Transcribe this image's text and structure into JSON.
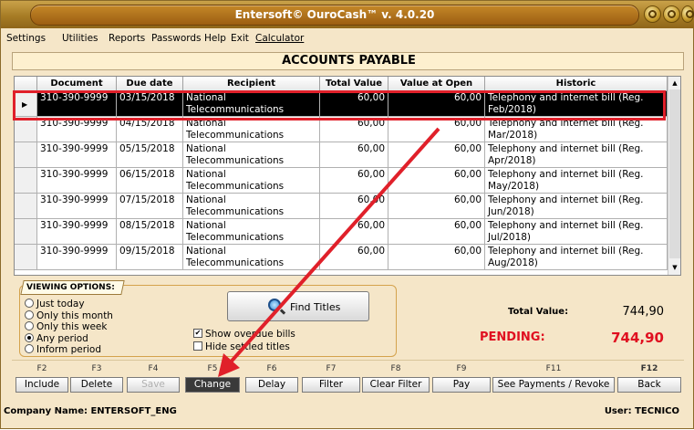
{
  "window": {
    "title": "Entersoft© OuroCash™ v. 4.0.20"
  },
  "menu": [
    "Settings",
    "Utilities",
    "Reports",
    "Passwords",
    "Help",
    "Exit",
    "Calculator"
  ],
  "header": "ACCOUNTS PAYABLE",
  "table": {
    "columns": [
      "Document",
      "Due date",
      "Recipient",
      "Total Value",
      "Value at Open",
      "Historic"
    ],
    "rows": [
      {
        "document": "310-390-9999",
        "due": "03/15/2018",
        "recipient": "National Telecommunications Company S/A",
        "total": "60,00",
        "open": "60,00",
        "historic": "Telephony and internet bill (Reg. Feb/2018)",
        "selected": true
      },
      {
        "document": "310-390-9999",
        "due": "04/15/2018",
        "recipient": "National Telecommunications Company S/A",
        "total": "60,00",
        "open": "60,00",
        "historic": "Telephony and internet bill (Reg. Mar/2018)"
      },
      {
        "document": "310-390-9999",
        "due": "05/15/2018",
        "recipient": "National Telecommunications Company S/A",
        "total": "60,00",
        "open": "60,00",
        "historic": "Telephony and internet bill (Reg. Apr/2018)"
      },
      {
        "document": "310-390-9999",
        "due": "06/15/2018",
        "recipient": "National Telecommunications Company S/A",
        "total": "60,00",
        "open": "60,00",
        "historic": "Telephony and internet bill (Reg. May/2018)"
      },
      {
        "document": "310-390-9999",
        "due": "07/15/2018",
        "recipient": "National Telecommunications Company S/A",
        "total": "60,00",
        "open": "60,00",
        "historic": "Telephony and internet bill (Reg. Jun/2018)"
      },
      {
        "document": "310-390-9999",
        "due": "08/15/2018",
        "recipient": "National Telecommunications Company S/A",
        "total": "60,00",
        "open": "60,00",
        "historic": "Telephony and internet bill (Reg. Jul/2018)"
      },
      {
        "document": "310-390-9999",
        "due": "09/15/2018",
        "recipient": "National Telecommunications Company S/A",
        "total": "60,00",
        "open": "60,00",
        "historic": "Telephony and internet bill (Reg. Aug/2018)"
      }
    ]
  },
  "viewing": {
    "title": "VIEWING OPTIONS:",
    "options": [
      "Just today",
      "Only this month",
      "Only this week",
      "Any period",
      "Inform period"
    ],
    "selected": 3
  },
  "find_button": "Find Titles",
  "checks": {
    "overdue": "Show overdue bills",
    "hide": "Hide settled titles",
    "overdue_checked": true
  },
  "totals": {
    "total_label": "Total Value:",
    "total_value": "744,90",
    "pending_label": "PENDING:",
    "pending_value": "744,90"
  },
  "fkeys": [
    {
      "key": "F2",
      "label": "Include"
    },
    {
      "key": "F3",
      "label": "Delete"
    },
    {
      "key": "F4",
      "label": "Save"
    },
    {
      "key": "F5",
      "label": "Change"
    },
    {
      "key": "F6",
      "label": "Delay"
    },
    {
      "key": "F7",
      "label": "Filter"
    },
    {
      "key": "F8",
      "label": "Clear Filter"
    },
    {
      "key": "F9",
      "label": "Pay"
    },
    {
      "key": "F11",
      "label": "See Payments / Revoke"
    },
    {
      "key": "F12",
      "label": "Back"
    }
  ],
  "status": {
    "company": "Company Name: ENTERSOFT_ENG",
    "user": "User: TECNICO"
  },
  "colors": {
    "accent": "#e01020",
    "window_bg": "#f5e6c8",
    "selected_row": "#000000"
  }
}
